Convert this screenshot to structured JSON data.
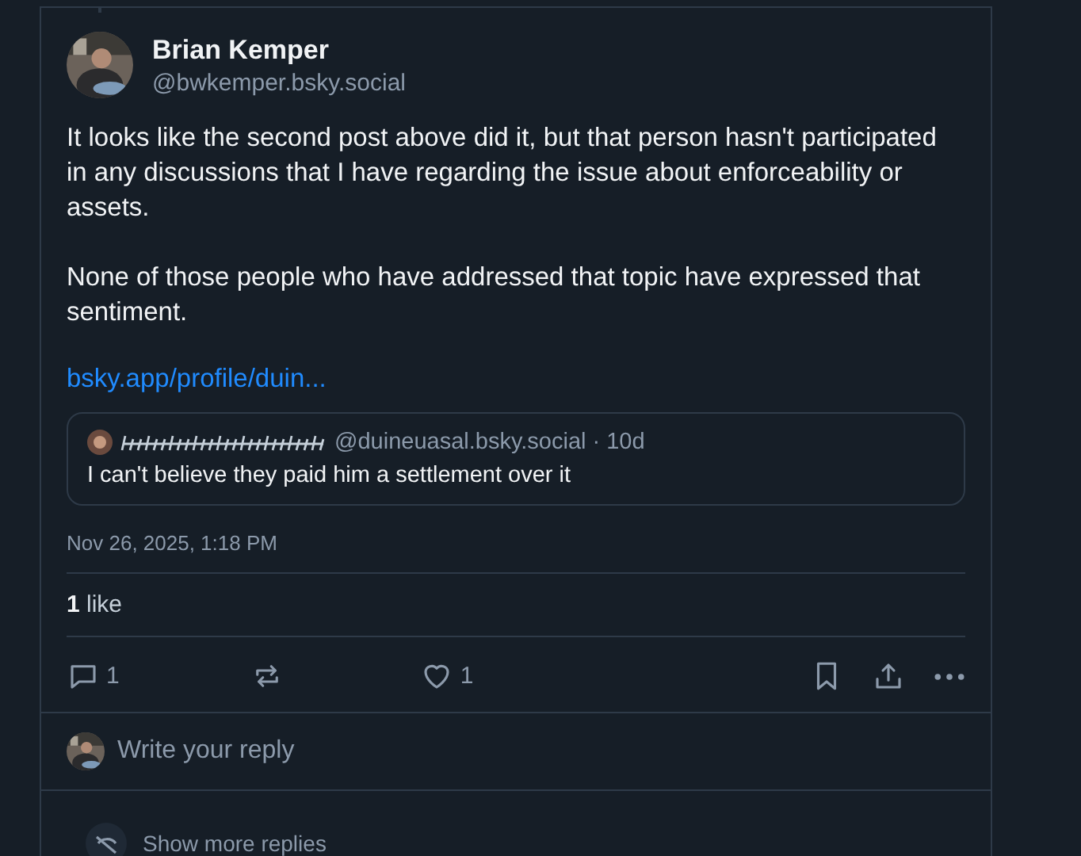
{
  "author": {
    "name": "Brian Kemper",
    "handle": "@bwkemper.bsky.social"
  },
  "body": [
    "It looks like the second post above did it, but that person hasn't participated in any discussions that I have regarding the issue about enforceability or assets.",
    "None of those people who have addressed that topic have expressed that sentiment."
  ],
  "link": "bsky.app/profile/duin...",
  "quote": {
    "handle": "@duineuasal.bsky.social",
    "age": "· 10d",
    "text": "I can't believe they paid him a settlement over it"
  },
  "timestamp": "Nov 26, 2025, 1:18 PM",
  "likes": {
    "count": "1",
    "label": "like"
  },
  "actions": {
    "replies": "1",
    "likes": "1"
  },
  "reply_placeholder": "Write your reply",
  "more_replies": "Show more replies"
}
